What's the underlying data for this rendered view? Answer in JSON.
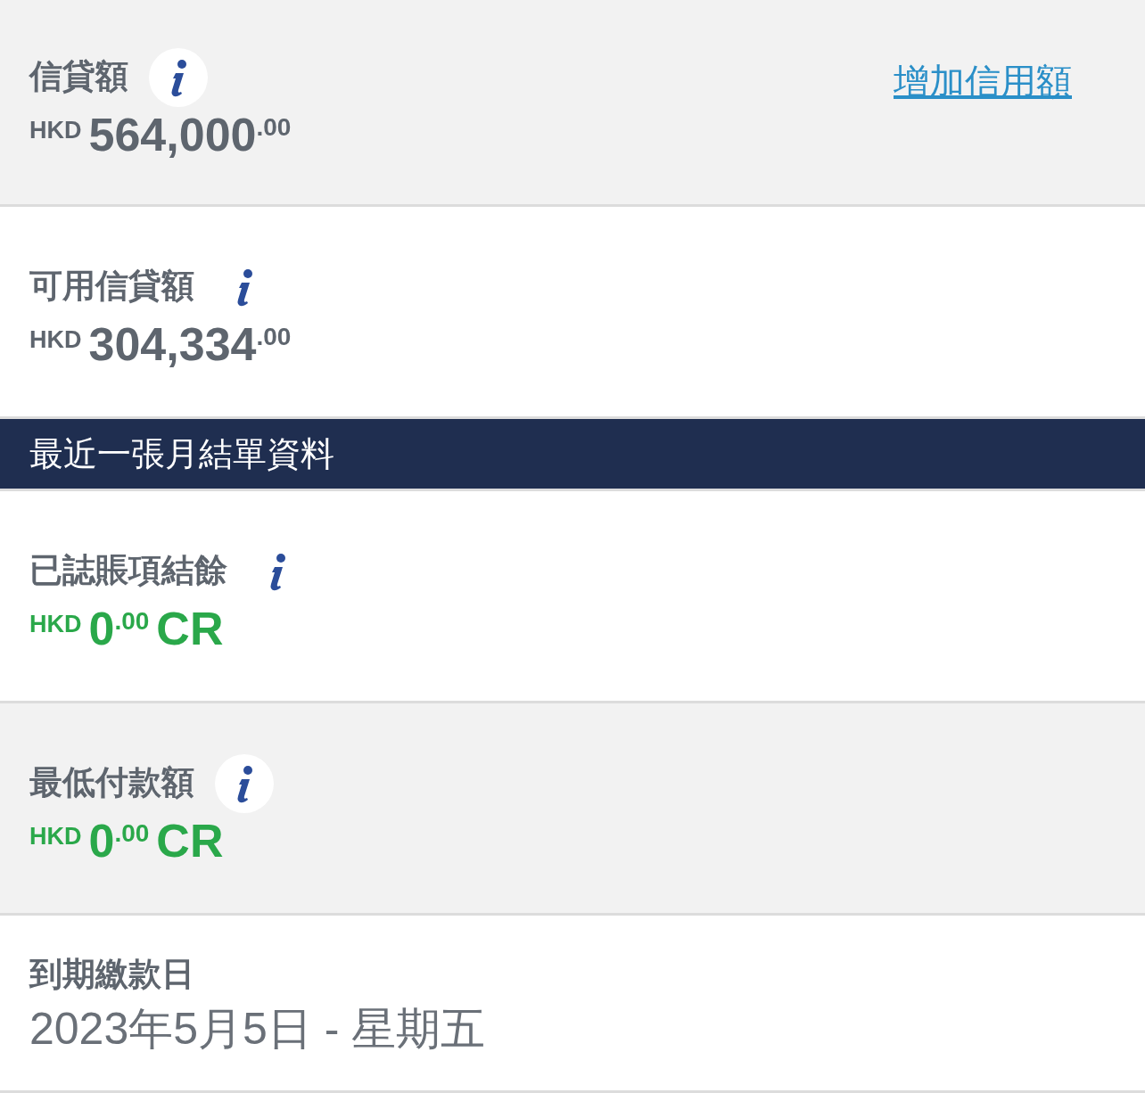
{
  "sections": [
    {
      "kind": "amount",
      "shaded": true,
      "label": "信貸額",
      "link": "增加信用額",
      "amount": {
        "currency": "HKD",
        "whole": "564,000",
        "decimal": ".00",
        "color": "#5e656e"
      }
    },
    {
      "kind": "amount",
      "shaded": false,
      "label": "可用信貸額",
      "amount": {
        "currency": "HKD",
        "whole": "304,334",
        "decimal": ".00",
        "color": "#5e656e"
      }
    },
    {
      "kind": "header",
      "title": "最近一張月結單資料"
    },
    {
      "kind": "amount",
      "shaded": false,
      "label": "已誌賬項結餘",
      "amount": {
        "currency": "HKD",
        "whole": "0",
        "decimal": ".00",
        "suffix": "CR",
        "color": "#2aa84a"
      }
    },
    {
      "kind": "amount",
      "shaded": true,
      "label": "最低付款額",
      "amount": {
        "currency": "HKD",
        "whole": "0",
        "decimal": ".00",
        "suffix": "CR",
        "color": "#2aa84a"
      }
    },
    {
      "kind": "date",
      "shaded": false,
      "label": "到期繳款日",
      "value": "2023年5月5日 - 星期五"
    }
  ]
}
